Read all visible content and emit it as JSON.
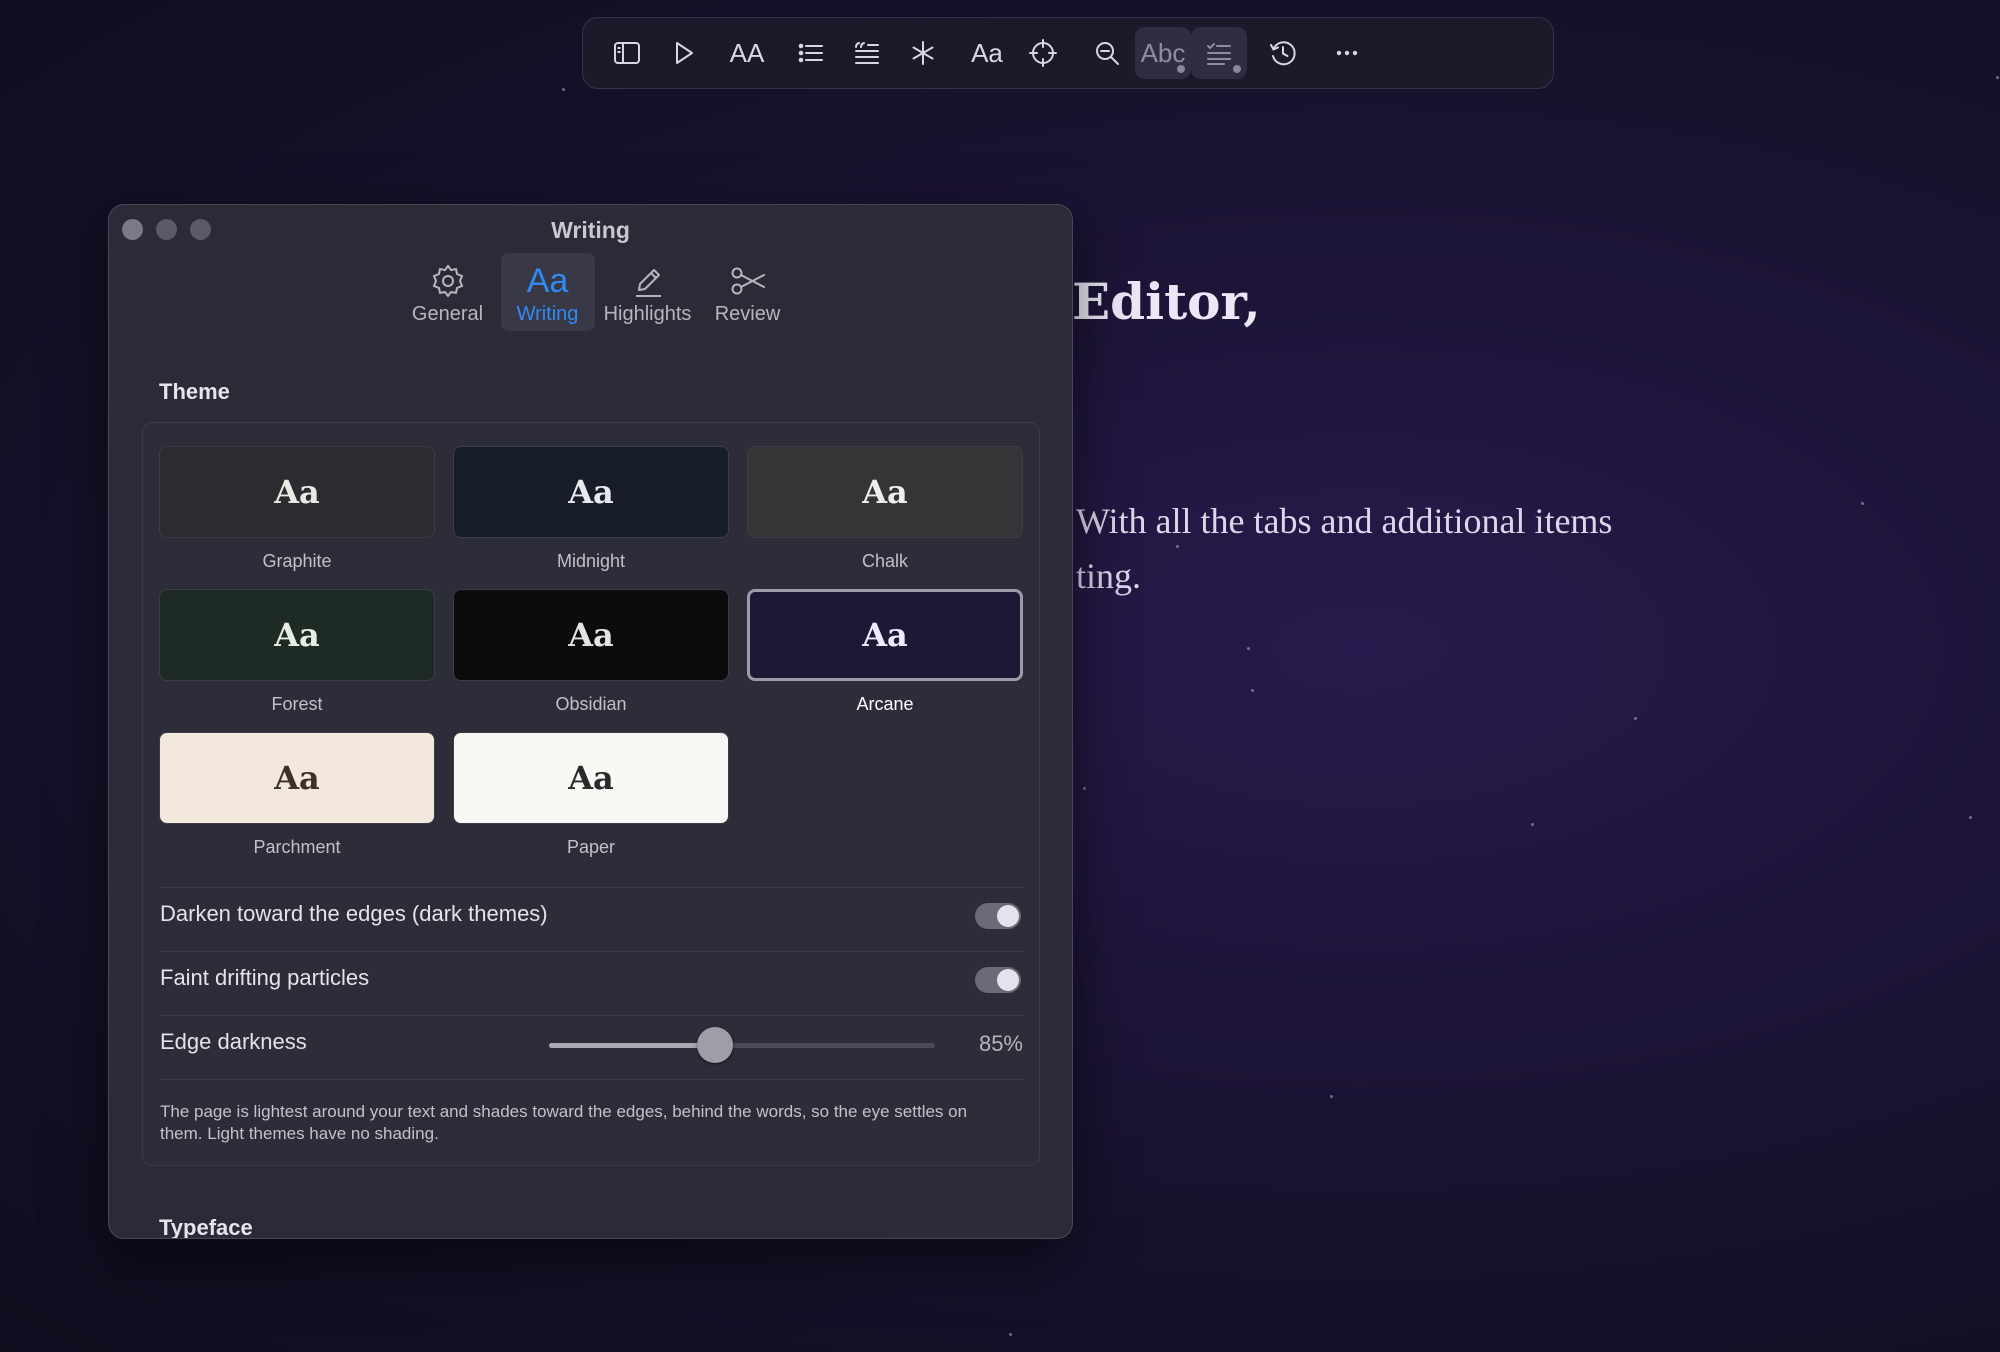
{
  "toolbar": {
    "items": [
      {
        "icon": "sidebar-icon"
      },
      {
        "icon": "play-icon"
      },
      {
        "icon": "text-size-icon",
        "text": "AA"
      },
      {
        "icon": "bulleted-list-icon"
      },
      {
        "icon": "quote-block-icon"
      },
      {
        "icon": "asterisk-icon"
      },
      {
        "icon": "font-icon",
        "text": "Aa"
      },
      {
        "icon": "crosshair-icon"
      },
      {
        "icon": "zoom-out-icon"
      },
      {
        "icon": "spellcheck-icon",
        "text": "Abc"
      },
      {
        "icon": "checklist-icon"
      },
      {
        "icon": "history-icon"
      },
      {
        "icon": "more-icon"
      }
    ]
  },
  "document": {
    "heading_fragment": "Editor,",
    "line1_fragment": "With all the tabs and additional items",
    "line2_fragment": "ting."
  },
  "window": {
    "title": "Writing",
    "tabs": [
      {
        "label": "General",
        "icon": "gear-icon"
      },
      {
        "label": "Writing",
        "icon": "Aa",
        "selected": true
      },
      {
        "label": "Highlights",
        "icon": "pencil-icon"
      },
      {
        "label": "Review",
        "icon": "scissors-icon"
      }
    ],
    "theme_section_title": "Theme",
    "themes": [
      {
        "name": "Graphite",
        "sample": "Aa",
        "bg": "#2c2b2f",
        "fg": "#ece9e4"
      },
      {
        "name": "Midnight",
        "sample": "Aa",
        "bg": "#171d29",
        "fg": "#e7e9ee"
      },
      {
        "name": "Chalk",
        "sample": "Aa",
        "bg": "#353537",
        "fg": "#eeeeee"
      },
      {
        "name": "Forest",
        "sample": "Aa",
        "bg": "#1e2a24",
        "fg": "#e8ece6"
      },
      {
        "name": "Obsidian",
        "sample": "Aa",
        "bg": "#0c0c0e",
        "fg": "#e5e4e0"
      },
      {
        "name": "Arcane",
        "sample": "Aa",
        "bg": "#1e1836",
        "fg": "#efeaff",
        "selected": true
      },
      {
        "name": "Parchment",
        "sample": "Aa",
        "bg": "#f2e8dc",
        "fg": "#3b3128"
      },
      {
        "name": "Paper",
        "sample": "Aa",
        "bg": "#f8f8f5",
        "fg": "#2a2a2a"
      }
    ],
    "darken_edges_label": "Darken toward the edges (dark themes)",
    "darken_edges_on": true,
    "particles_label": "Faint drifting particles",
    "particles_on": true,
    "edge_darkness_label": "Edge darkness",
    "edge_darkness_value": "85%",
    "edge_darkness_fraction": 0.43,
    "note": "The page is lightest around your text and shades toward the edges, behind the words, so the eye settles on them. Light themes have no shading.",
    "typeface_section_title": "Typeface"
  }
}
